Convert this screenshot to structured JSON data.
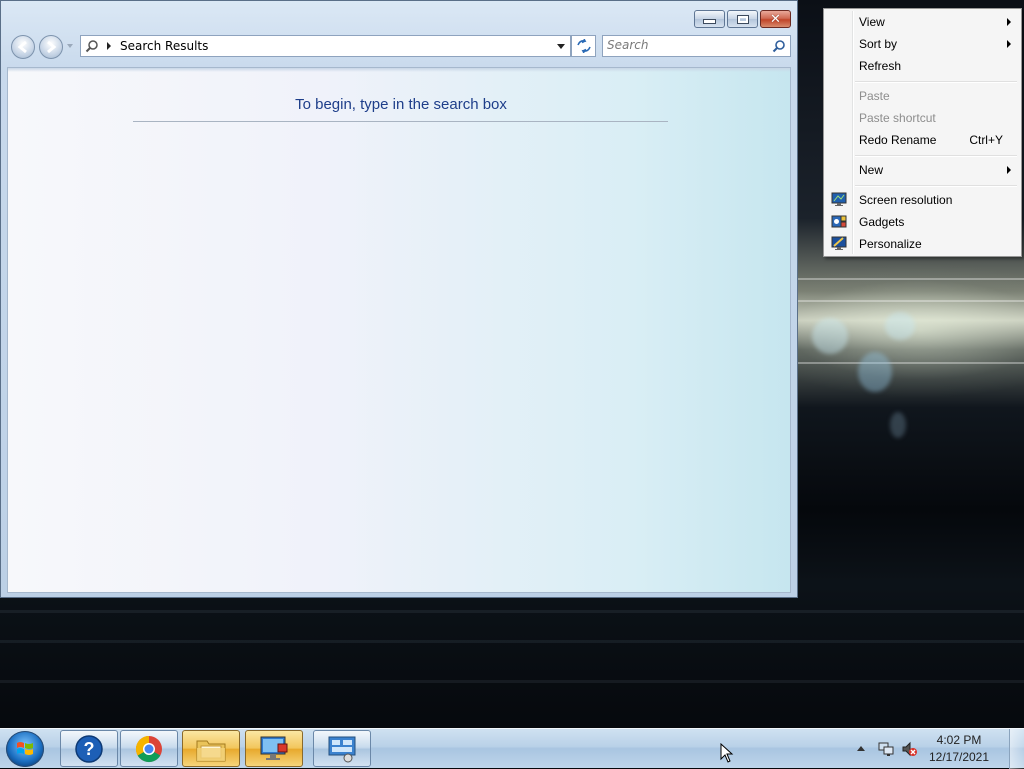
{
  "explorer": {
    "address": {
      "location": "Search Results"
    },
    "search": {
      "placeholder": "Search"
    },
    "content": {
      "hint": "To begin, type in the search box"
    }
  },
  "context_menu": {
    "items": [
      {
        "label": "View",
        "submenu": true,
        "enabled": true
      },
      {
        "label": "Sort by",
        "submenu": true,
        "enabled": true
      },
      {
        "label": "Refresh",
        "enabled": true
      },
      {
        "label": "Paste",
        "enabled": false
      },
      {
        "label": "Paste shortcut",
        "enabled": false
      },
      {
        "label": "Redo Rename",
        "shortcut": "Ctrl+Y",
        "enabled": true
      },
      {
        "label": "New",
        "submenu": true,
        "enabled": true
      },
      {
        "label": "Screen resolution",
        "icon": "screen-resolution-icon",
        "enabled": true
      },
      {
        "label": "Gadgets",
        "icon": "gadgets-icon",
        "enabled": true
      },
      {
        "label": "Personalize",
        "icon": "personalize-icon",
        "enabled": true
      }
    ]
  },
  "taskbar": {
    "pinned": [
      {
        "name": "help-and-support",
        "icon": "help-icon"
      },
      {
        "name": "google-chrome",
        "icon": "chrome-icon"
      },
      {
        "name": "windows-explorer",
        "icon": "folder-icon",
        "active": true
      },
      {
        "name": "remote-desktop",
        "icon": "monitor-icon",
        "active": true
      },
      {
        "name": "control-panel",
        "icon": "control-panel-icon"
      }
    ],
    "clock": {
      "time": "4:02 PM",
      "date": "12/17/2021"
    }
  },
  "colors": {
    "hint_text": "#1e3e8a",
    "disabled_text": "#8d8d8d",
    "close_button": "#c14529",
    "active_taskbar": "#f2c55b"
  }
}
